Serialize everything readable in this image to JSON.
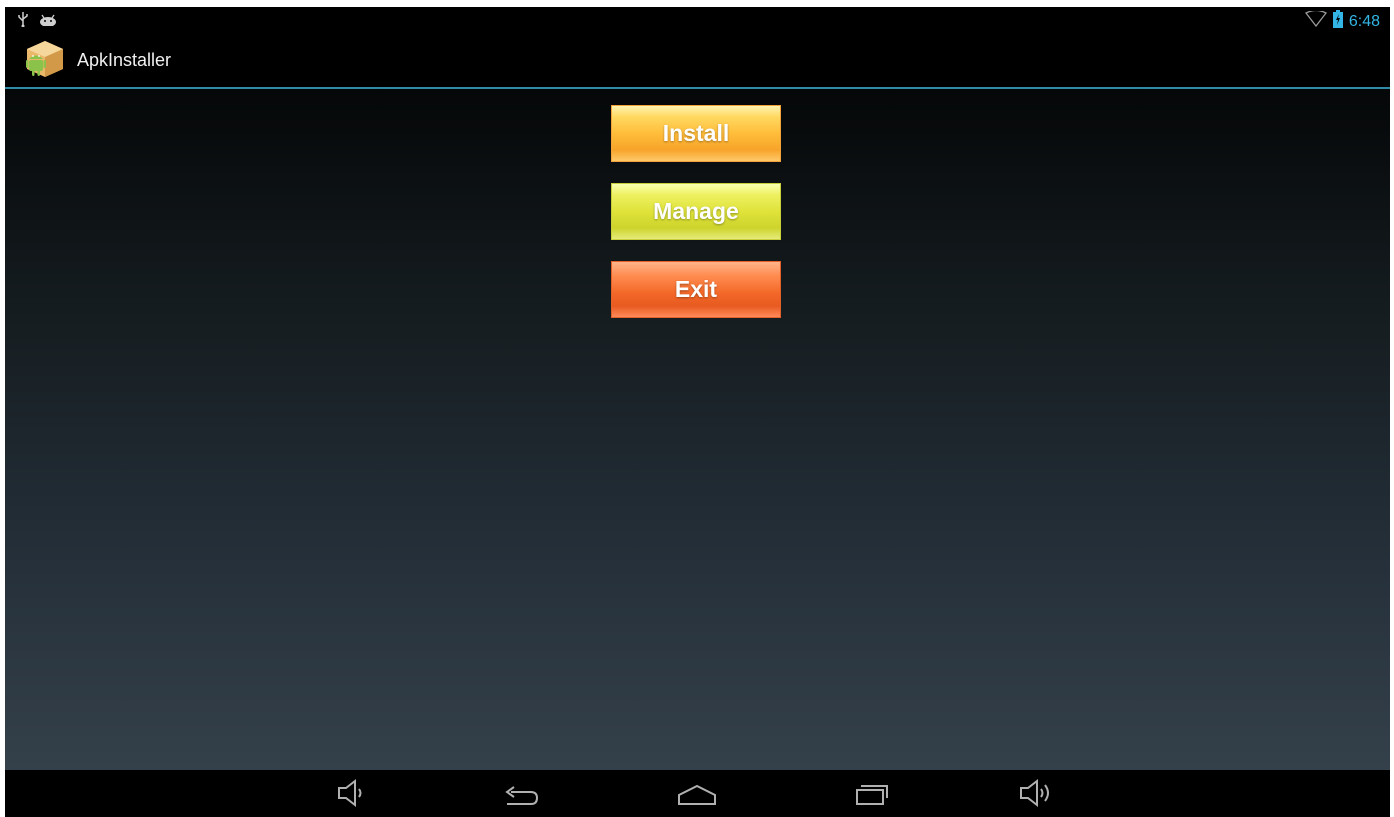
{
  "status_bar": {
    "time": "6:48",
    "icons": [
      "usb-icon",
      "android-debug-icon",
      "wifi-icon",
      "battery-charging-icon"
    ]
  },
  "action_bar": {
    "title": "ApkInstaller",
    "icon": "apk-installer-app-icon"
  },
  "buttons": {
    "install": "Install",
    "manage": "Manage",
    "exit": "Exit"
  },
  "nav_bar": {
    "icons": [
      "volume-down-icon",
      "back-icon",
      "home-icon",
      "recent-apps-icon",
      "volume-up-icon"
    ]
  },
  "colors": {
    "accent": "#33b5e5",
    "divider": "#2f8aa5",
    "install": "#ffbd3a",
    "manage": "#dfe33a",
    "exit": "#f46a2a"
  }
}
